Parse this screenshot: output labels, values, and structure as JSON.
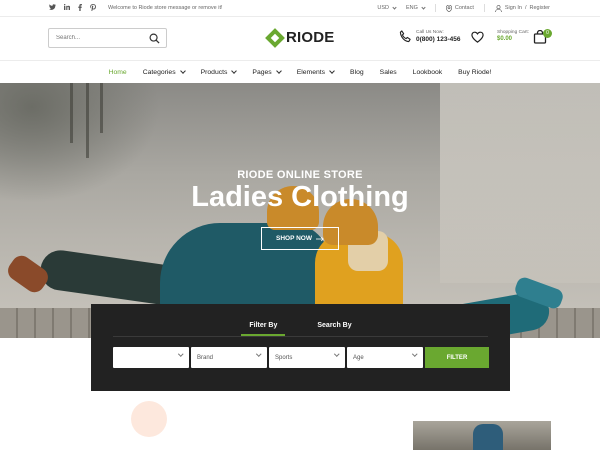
{
  "topbar": {
    "social": [
      "twitter-icon",
      "linkedin-icon",
      "facebook-icon",
      "pinterest-icon"
    ],
    "welcome": "Welcome to Riode store message or remove it!",
    "currency": "USD",
    "language": "ENG",
    "contact": "Contact",
    "sign_in": "Sign In",
    "separator": "/",
    "register": "Register"
  },
  "header": {
    "search_placeholder": "Search...",
    "logo": "RIODE",
    "call_label": "Call Us Now:",
    "phone": "0(800) 123-456",
    "cart_label": "Shopping Cart:",
    "cart_total": "$0.00",
    "cart_count": "0"
  },
  "nav": {
    "items": [
      {
        "label": "Home",
        "dropdown": false,
        "active": true
      },
      {
        "label": "Categories",
        "dropdown": true
      },
      {
        "label": "Products",
        "dropdown": true
      },
      {
        "label": "Pages",
        "dropdown": true
      },
      {
        "label": "Elements",
        "dropdown": true
      },
      {
        "label": "Blog",
        "dropdown": false
      },
      {
        "label": "Sales",
        "dropdown": false
      },
      {
        "label": "Lookbook",
        "dropdown": false
      },
      {
        "label": "Buy Riode!",
        "dropdown": false
      }
    ]
  },
  "hero": {
    "subtitle": "RIODE ONLINE STORE",
    "title": "Ladies Clothing",
    "button": "SHOP NOW"
  },
  "filter": {
    "tabs": [
      "Filter By",
      "Search By"
    ],
    "active_tab": "Filter By",
    "selects": [
      "",
      "Brand",
      "Sports",
      "Age"
    ],
    "button": "FILTER"
  },
  "colors": {
    "accent": "#6aa830",
    "panel": "#222222"
  }
}
